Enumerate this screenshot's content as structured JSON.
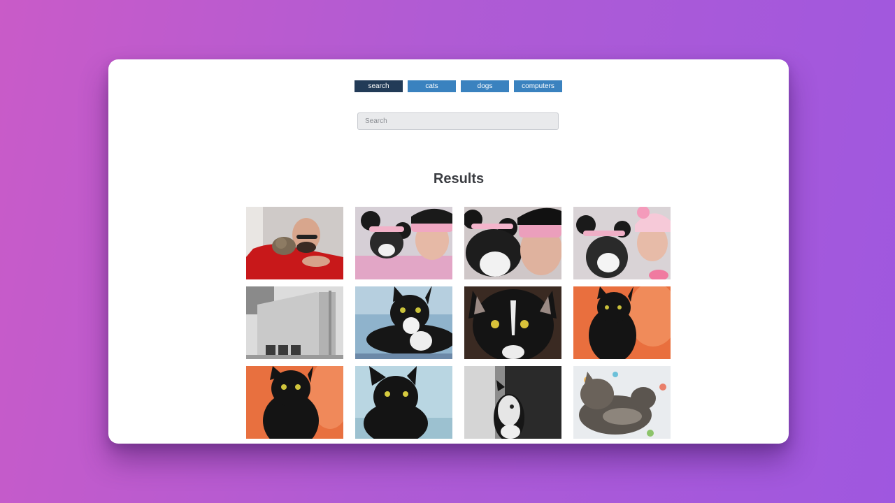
{
  "tabs": [
    {
      "label": "search",
      "active": true
    },
    {
      "label": "cats",
      "active": false
    },
    {
      "label": "dogs",
      "active": false
    },
    {
      "label": "computers",
      "active": false
    }
  ],
  "search": {
    "placeholder": "Search",
    "value": ""
  },
  "results": {
    "title": "Results"
  },
  "colors": {
    "tab_bg": "#3a82bf",
    "tab_active": "#223b57",
    "page_gradient_start": "#c95bc8",
    "page_gradient_end": "#9f57df"
  }
}
